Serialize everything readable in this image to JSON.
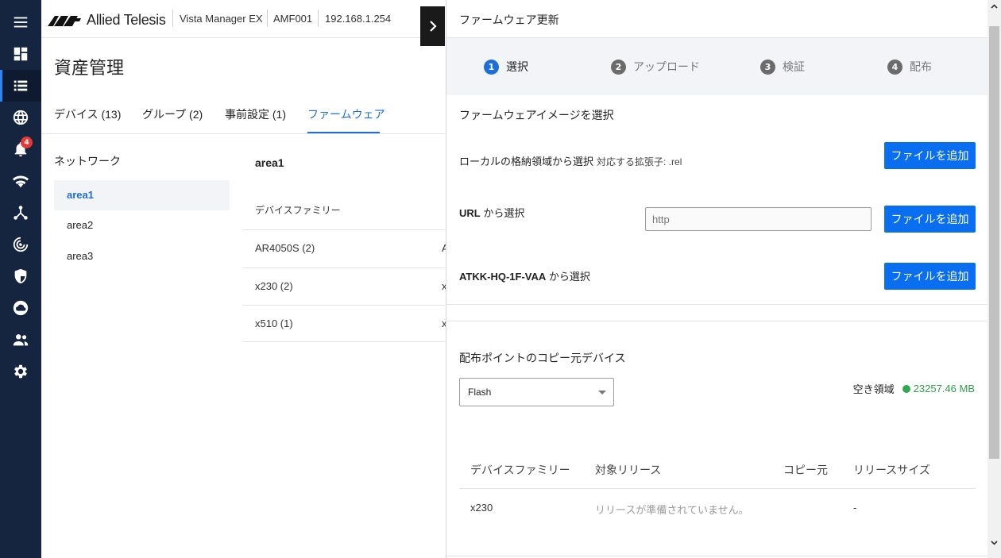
{
  "brand": {
    "logo_text": "Allied Telesis",
    "product": "Vista Manager EX",
    "amf_name": "AMF001",
    "ip": "192.168.1.254"
  },
  "sidebar": {
    "alert_count": "4"
  },
  "page": {
    "title": "資産管理",
    "tabs": [
      "デバイス (13)",
      "グループ (2)",
      "事前設定 (1)",
      "ファームウェア"
    ],
    "network_title": "ネットワーク",
    "network_items": [
      "area1",
      "area2",
      "area3"
    ],
    "area_title": "area1",
    "device_header": "デバイスファミリー",
    "device_rows": [
      {
        "family": "AR4050S (2)",
        "cut": "A"
      },
      {
        "family": "x230 (2)",
        "cut": "x"
      },
      {
        "family": "x510 (1)",
        "cut": "x"
      }
    ]
  },
  "panel": {
    "title": "ファームウェア更新",
    "steps": [
      {
        "num": "1",
        "label": "選択"
      },
      {
        "num": "2",
        "label": "アップロード"
      },
      {
        "num": "3",
        "label": "検証"
      },
      {
        "num": "4",
        "label": "配布"
      }
    ],
    "section_select": "ファームウェアイメージを選択",
    "local_label": "ローカルの格納領域から選択",
    "local_hint": "対応する拡張子: .rel",
    "url_label_bold": "URL",
    "url_label_rest": " から選択",
    "url_placeholder": "http",
    "atkk_label_bold": "ATKK-HQ-1F-VAA",
    "atkk_label_rest": " から選択",
    "add_file_label": "ファイルを追加",
    "copy_source_title": "配布ポイントのコピー元デバイス",
    "storage_selected": "Flash",
    "free_space_label": "空き領域",
    "free_space_value": "23257.46 MB",
    "free_space_color": "#2fa84f",
    "table_headers": [
      "デバイスファミリー",
      "対象リリース",
      "コピー元",
      "リリースサイズ"
    ],
    "table_rows": [
      {
        "family": "x230",
        "release": "リリースが準備されていません。",
        "source": "",
        "size": "-"
      }
    ]
  },
  "colors": {
    "sidebar_bg": "#16253f",
    "accent": "#1c6fd6",
    "button": "#0a6ef0",
    "alert": "#e53935"
  }
}
